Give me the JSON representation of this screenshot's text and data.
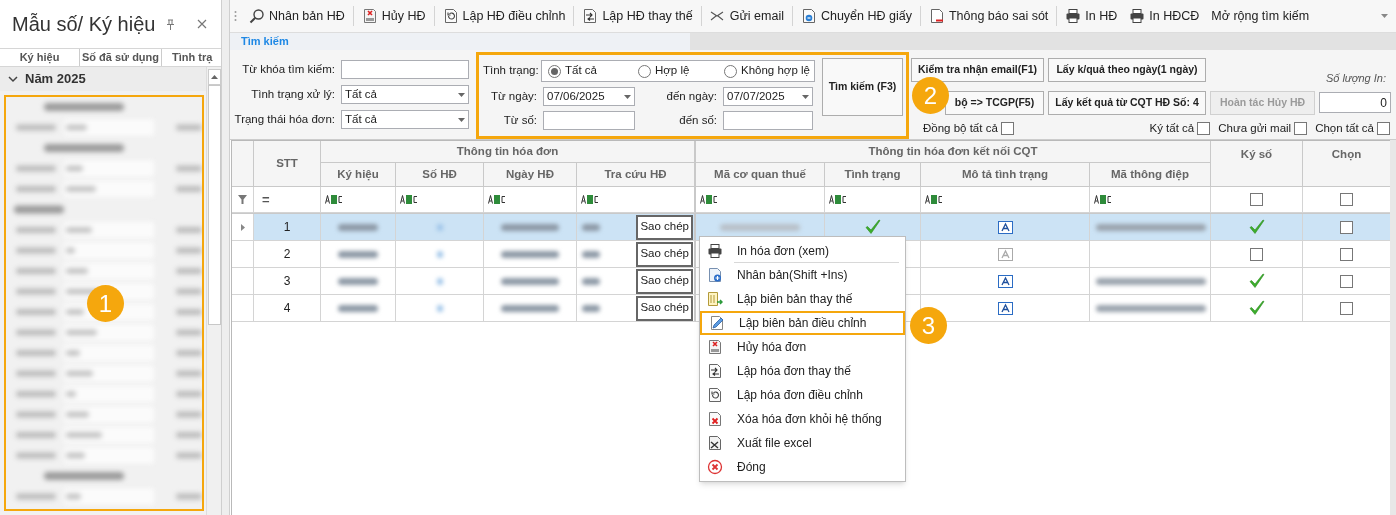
{
  "sidebar": {
    "title": "Mẫu số/ Ký hiệu",
    "columns": [
      "Ký hiệu",
      "Số đã sử dụng",
      "Tình trạ"
    ],
    "group": {
      "label": "Năm 2025",
      "expanded": true
    }
  },
  "toolbar": {
    "items": [
      {
        "label": "Nhân bản HĐ"
      },
      {
        "label": "Hủy HĐ"
      },
      {
        "label": "Lập HĐ điều chỉnh"
      },
      {
        "label": "Lập HĐ thay thế"
      },
      {
        "label": "Gửi email"
      },
      {
        "label": "Chuyển HĐ giấy"
      },
      {
        "label": "Thông báo sai sót"
      },
      {
        "label": "In HĐ"
      },
      {
        "label": "In HĐCĐ"
      },
      {
        "label": "Mở rộng tìm kiếm"
      }
    ]
  },
  "search_tab": {
    "title": "Tìm kiếm"
  },
  "search_form": {
    "keyword": {
      "label": "Từ khóa tìm kiếm:"
    },
    "processing_status": {
      "label": "Tình trạng xử lý:",
      "value": "Tất cả"
    },
    "invoice_state": {
      "label": "Trạng thái hóa đơn:",
      "value": "Tất cả"
    },
    "status": {
      "label": "Tình trạng:",
      "options": [
        {
          "label": "Tất cả",
          "selected": true
        },
        {
          "label": "Hợp lệ",
          "selected": false
        },
        {
          "label": "Không hợp lệ",
          "selected": false
        }
      ]
    },
    "from_date": {
      "label": "Từ ngày:",
      "value": "07/06/2025"
    },
    "to_date": {
      "label": "đến ngày:",
      "value": "07/07/2025"
    },
    "from_number": {
      "label": "Từ số:"
    },
    "to_number": {
      "label": "đến số:"
    },
    "search_button": "Tìm kiếm (F3)"
  },
  "actions": {
    "buttons": [
      {
        "label": "Kiểm tra nhận email(F1)",
        "disabled": false
      },
      {
        "label": "Lấy k/quả theo ngày(1 ngày)",
        "disabled": false
      },
      {
        "label": "bộ => TCGP(F5)",
        "disabled": false
      },
      {
        "label": "Lấy kết quả từ CQT HĐ Số: 4",
        "disabled": false
      },
      {
        "label": "Hoàn tác Hủy HĐ",
        "disabled": true
      }
    ],
    "print_quantity": {
      "label": "Số lượng In:",
      "value": "0"
    },
    "checkboxes": [
      {
        "label": "Đồng bộ tất cả",
        "checked": false
      },
      {
        "label": "Ký tất cả",
        "checked": false
      },
      {
        "label": "Chưa gửi mail",
        "checked": false
      },
      {
        "label": "Chọn tất cả",
        "checked": false
      }
    ]
  },
  "grid": {
    "bands": [
      "Thông tin hóa đơn",
      "Thông tin hóa đơn kết nối CQT"
    ],
    "columns": [
      "STT",
      "Ký hiệu",
      "Số HĐ",
      "Ngày HĐ",
      "Tra cứu HĐ",
      "Mã cơ quan thuế",
      "Tình trạng",
      "Mô tả tình trạng",
      "Mã thông điệp",
      "Ký số",
      "Chọn"
    ],
    "filter": {
      "stt": "=",
      "sign_checked": false,
      "choose_checked": false
    },
    "rows": [
      {
        "stt": "1",
        "selected": true,
        "copy_button": "Sao chép",
        "status_ok": true,
        "description_active": true,
        "message_blurred": true,
        "signed": true,
        "checked": false
      },
      {
        "stt": "2",
        "selected": false,
        "copy_button": "Sao chép",
        "description_active": false,
        "message_blurred": false,
        "signed": false,
        "checked": false
      },
      {
        "stt": "3",
        "selected": false,
        "copy_button": "Sao chép",
        "description_active": true,
        "message_blurred": true,
        "signed": true,
        "checked": false
      },
      {
        "stt": "4",
        "selected": false,
        "copy_button": "Sao chép",
        "description_active": true,
        "message_blurred": true,
        "signed": true,
        "checked": false
      }
    ]
  },
  "context_menu": {
    "items": [
      {
        "label": "In hóa đơn (xem)",
        "separator_after": true,
        "highlighted": false
      },
      {
        "label": "Nhân bản(Shift +Ins)",
        "separator_after": false,
        "highlighted": false
      },
      {
        "label": "Lập biên bản thay thế",
        "separator_after": false,
        "highlighted": false
      },
      {
        "label": "Lập biên bản điều chỉnh",
        "separator_after": false,
        "highlighted": true
      },
      {
        "label": "Hủy hóa đơn",
        "separator_after": false,
        "highlighted": false
      },
      {
        "label": "Lập hóa đơn thay thế",
        "separator_after": false,
        "highlighted": false
      },
      {
        "label": "Lập hóa đơn điều chỉnh",
        "separator_after": false,
        "highlighted": false
      },
      {
        "label": "Xóa hóa đơn khỏi hệ thống",
        "separator_after": false,
        "highlighted": false
      },
      {
        "label": "Xuất file excel",
        "separator_after": false,
        "highlighted": false
      },
      {
        "label": "Đóng",
        "separator_after": false,
        "highlighted": false
      }
    ]
  },
  "callouts": [
    {
      "label": "1"
    },
    {
      "label": "2"
    },
    {
      "label": "3"
    }
  ]
}
